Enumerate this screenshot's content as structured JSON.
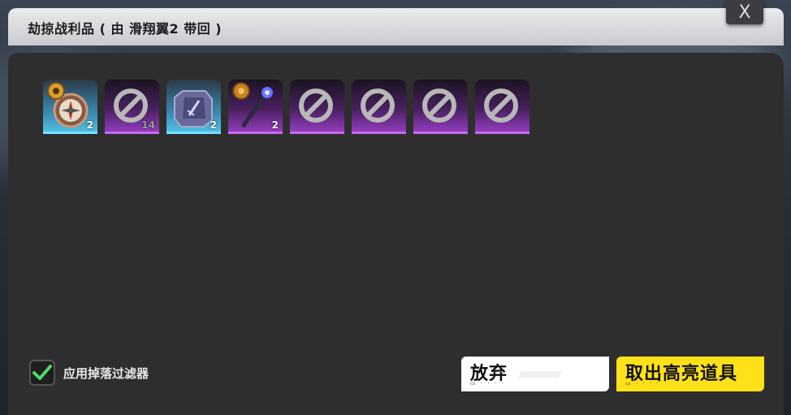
{
  "dialog": {
    "title": "劫掠战利品 ( 由 滑翔翼2 带回 )",
    "close_label": "X"
  },
  "loot": [
    {
      "icon": "compass-icon",
      "rarity": "blue",
      "count": "2"
    },
    {
      "icon": "blocked-icon",
      "rarity": "purple",
      "count": "14"
    },
    {
      "icon": "sword-crate-icon",
      "rarity": "blue",
      "count": "2"
    },
    {
      "icon": "staff-icon",
      "rarity": "purple",
      "count": "2"
    },
    {
      "icon": "blocked-icon",
      "rarity": "purple",
      "count": ""
    },
    {
      "icon": "blocked-icon",
      "rarity": "purple",
      "count": ""
    },
    {
      "icon": "blocked-icon",
      "rarity": "purple",
      "count": ""
    },
    {
      "icon": "blocked-icon",
      "rarity": "purple",
      "count": ""
    }
  ],
  "filter": {
    "label": "应用掉落过滤器",
    "checked": true,
    "check_color": "#4cd964"
  },
  "buttons": {
    "discard_label": "放弃",
    "take_label": "取出高亮道具",
    "take_color": "#ffe11a"
  }
}
